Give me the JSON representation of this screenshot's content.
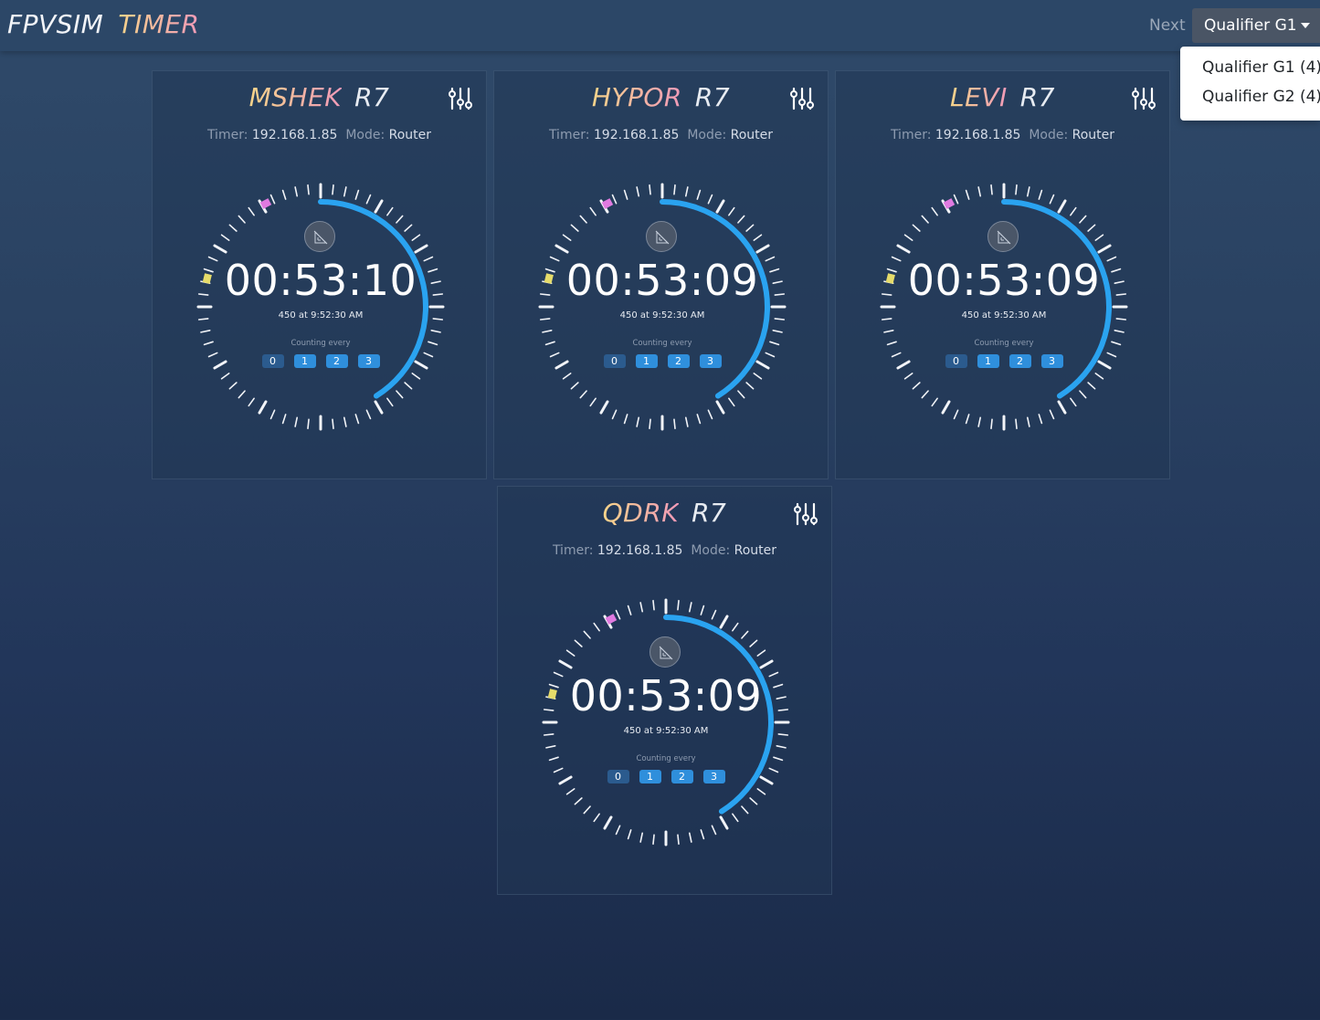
{
  "navbar": {
    "brand_primary": "FPVSIM",
    "brand_secondary": "TIMER",
    "next_label": "Next",
    "selected_round": "Qualifier G1",
    "menu_items": [
      "Qualifier G1 (4)",
      "Qualifier G2 (4)"
    ]
  },
  "labels": {
    "timer": "Timer:",
    "mode": "Mode:",
    "counting_every": "Counting every"
  },
  "colors": {
    "progress_arc": "#2aa3f0",
    "marker_magenta": "#e07ae0",
    "marker_yellow": "#e6dc6a",
    "chip": "#2f8fdc"
  },
  "cards": [
    {
      "pilot": "MSHEK",
      "craft": "R7",
      "timer_ip": "192.168.1.85",
      "mode": "Router",
      "time": "00:53:10",
      "detail": "450 at 9:52:30 AM",
      "chips": [
        "0",
        "1",
        "2",
        "3"
      ]
    },
    {
      "pilot": "HYPOR",
      "craft": "R7",
      "timer_ip": "192.168.1.85",
      "mode": "Router",
      "time": "00:53:09",
      "detail": "450 at 9:52:30 AM",
      "chips": [
        "0",
        "1",
        "2",
        "3"
      ]
    },
    {
      "pilot": "LEVI",
      "craft": "R7",
      "timer_ip": "192.168.1.85",
      "mode": "Router",
      "time": "00:53:09",
      "detail": "450 at 9:52:30 AM",
      "chips": [
        "0",
        "1",
        "2",
        "3"
      ]
    },
    {
      "pilot": "QDRK",
      "craft": "R7",
      "timer_ip": "192.168.1.85",
      "mode": "Router",
      "time": "00:53:09",
      "detail": "450 at 9:52:30 AM",
      "chips": [
        "0",
        "1",
        "2",
        "3"
      ]
    }
  ]
}
